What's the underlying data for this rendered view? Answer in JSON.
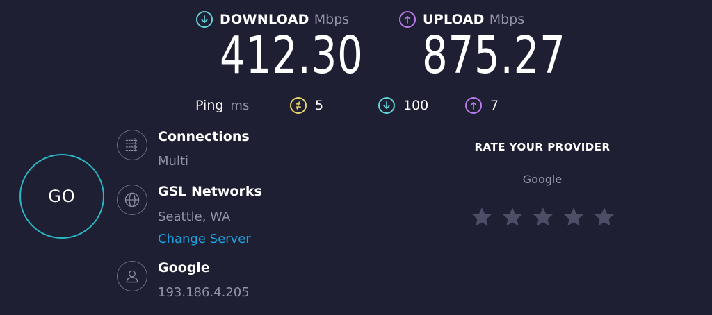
{
  "download": {
    "label": "DOWNLOAD",
    "unit": "Mbps",
    "value": "412.30",
    "icon": "download-arrow-icon",
    "color": "#5fd3d8"
  },
  "upload": {
    "label": "UPLOAD",
    "unit": "Mbps",
    "value": "875.27",
    "icon": "upload-arrow-icon",
    "color": "#b67be8"
  },
  "ping": {
    "label": "Ping",
    "unit": "ms",
    "idle": {
      "value": "5",
      "icon": "ping-lightning-icon",
      "color": "#e8d36b"
    },
    "download": {
      "value": "100",
      "icon": "download-arrow-icon",
      "color": "#5fd3d8"
    },
    "upload": {
      "value": "7",
      "icon": "upload-arrow-icon",
      "color": "#b67be8"
    }
  },
  "go_button": {
    "label": "GO",
    "border_color": "#2bb6c4"
  },
  "connections": {
    "title": "Connections",
    "value": "Multi",
    "icon": "connections-arrows-icon"
  },
  "server": {
    "title": "GSL Networks",
    "location": "Seattle, WA",
    "change_link": "Change Server",
    "icon": "globe-icon"
  },
  "provider": {
    "title": "Google",
    "ip": "193.186.4.205",
    "icon": "user-icon"
  },
  "rating": {
    "title": "RATE YOUR PROVIDER",
    "provider": "Google",
    "stars": 5,
    "rating_value": 0,
    "star_color": "#4d4e66"
  },
  "colors": {
    "background": "#1f1f33",
    "muted_text": "#9193a8",
    "link": "#1ba3e0"
  }
}
